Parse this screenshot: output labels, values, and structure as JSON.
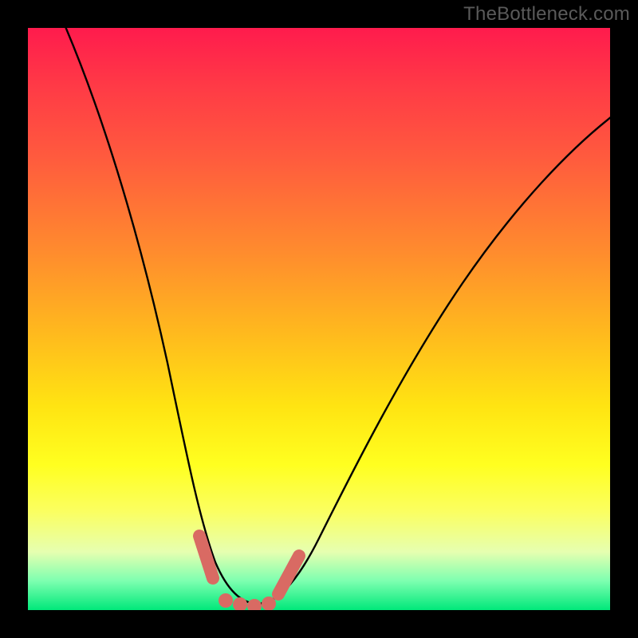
{
  "watermark": "TheBottleneck.com",
  "colors": {
    "frame_bg": "#000000",
    "marker": "#d96a63",
    "curve": "#000000",
    "gradient_top": "#ff1b4d",
    "gradient_bottom": "#00e87a"
  },
  "chart_data": {
    "type": "line",
    "title": "",
    "xlabel": "",
    "ylabel": "",
    "xlim": [
      0,
      100
    ],
    "ylim": [
      0,
      100
    ],
    "grid": false,
    "legend": null,
    "series": [
      {
        "name": "bottleneck-curve",
        "x": [
          0,
          4,
          8,
          12,
          16,
          20,
          24,
          27,
          30,
          33,
          36,
          40,
          45,
          50,
          55,
          60,
          66,
          72,
          78,
          85,
          92,
          100
        ],
        "y": [
          105,
          95,
          85,
          74,
          62,
          49,
          35,
          22,
          10,
          4,
          1,
          2,
          6,
          13,
          21,
          29,
          37,
          45,
          53,
          61,
          68,
          76
        ]
      }
    ],
    "marker_region": {
      "description": "coral markers near curve minimum",
      "x_range": [
        27,
        42
      ],
      "y_range": [
        0,
        10
      ]
    },
    "annotations": []
  }
}
